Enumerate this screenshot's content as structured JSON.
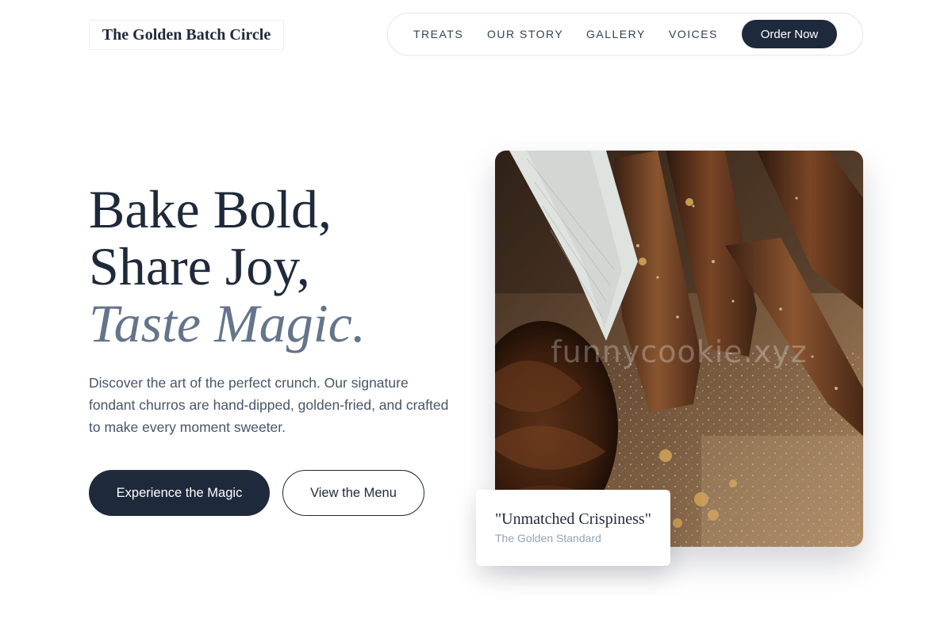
{
  "header": {
    "logo_text": "The Golden Batch Circle",
    "nav": [
      {
        "label": "TREATS"
      },
      {
        "label": "OUR STORY"
      },
      {
        "label": "GALLERY"
      },
      {
        "label": "VOICES"
      }
    ],
    "cta_label": "Order Now"
  },
  "hero": {
    "headline_line1": "Bake Bold,",
    "headline_line2": "Share Joy,",
    "headline_line3": "Taste Magic.",
    "description": "Discover the art of the perfect crunch. Our signature fondant churros are hand-dipped, golden-fried, and crafted to make every moment sweeter.",
    "primary_button": "Experience the Magic",
    "secondary_button": "View the Menu"
  },
  "image": {
    "watermark": "funnycookie.xyz"
  },
  "quote_card": {
    "title": "\"Unmatched Crispiness\"",
    "subtitle": "The Golden Standard"
  },
  "colors": {
    "primary_dark": "#1e293b",
    "accent_slate": "#64748b",
    "muted_text": "#94a3b8"
  }
}
